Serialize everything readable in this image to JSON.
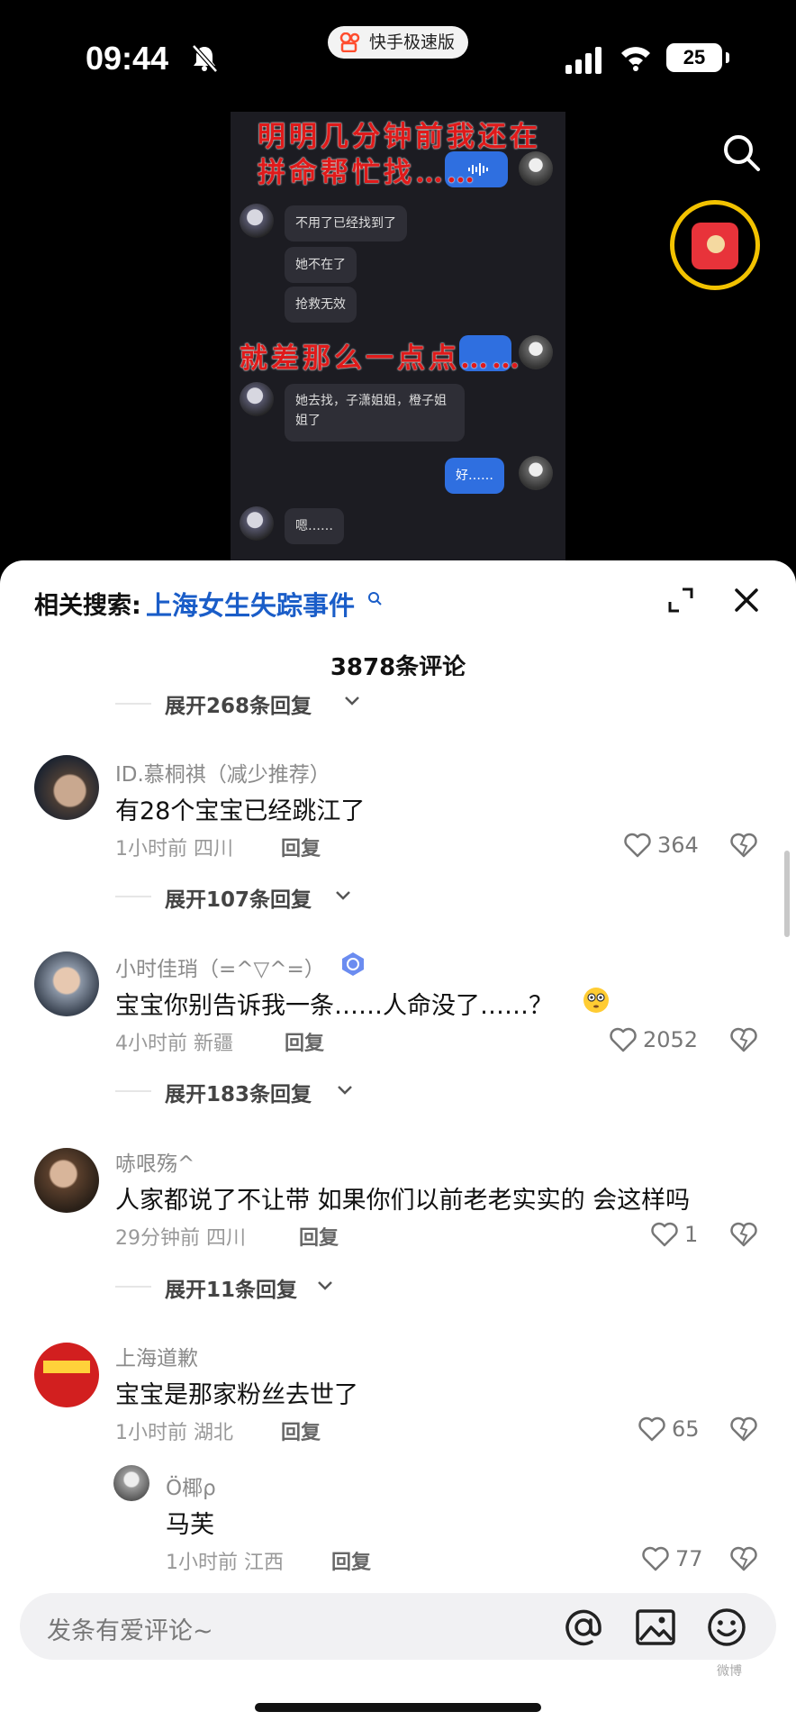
{
  "status_bar": {
    "time": "09:44",
    "app_name": "快手极速版",
    "battery": "25"
  },
  "video": {
    "overlay_top_line1": "明明几分钟前我还在",
    "overlay_top_line2": "拼命帮忙找……",
    "bubble_1": "不用了已经找到了",
    "bubble_2": "她不在了",
    "bubble_3": "抢救无效",
    "overlay_middle": "就差那么一点点……",
    "bubble_4_line1": "她去找，子潇姐姐，橙子姐",
    "bubble_4_line2": "姐了",
    "bubble_5": "好……",
    "bubble_6": "嗯……",
    "bubble_voice": "…"
  },
  "sheet": {
    "related_label": "相关搜索:",
    "related_link": "上海女生失踪事件",
    "comment_count": "3878条评论",
    "top_expand": "展开268条回复"
  },
  "comments": [
    {
      "user": "ID.慕桐祺（减少推荐）",
      "text": "有28个宝宝已经跳江了",
      "meta": "1小时前 四川",
      "reply": "回复",
      "likes": "364",
      "expand": "展开107条回复"
    },
    {
      "user": "小时佳琑（=^▽^=）",
      "text": "宝宝你别告诉我一条……人命没了……？",
      "meta": "4小时前 新疆",
      "reply": "回复",
      "likes": "2052",
      "expand": "展开183条回复"
    },
    {
      "user": "哧哏殇^",
      "text": "人家都说了不让带 如果你们以前老老实实的 会这样吗",
      "meta": "29分钟前 四川",
      "reply": "回复",
      "likes": "1",
      "expand": "展开11条回复"
    },
    {
      "user": "上海道歉",
      "text": "宝宝是那家粉丝去世了",
      "meta": "1小时前 湖北",
      "reply": "回复",
      "likes": "65"
    }
  ],
  "sub_reply": {
    "user": "Ö椰ρ",
    "text": "马芙",
    "meta": "1小时前 江西",
    "reply": "回复",
    "likes": "77"
  },
  "composer": {
    "placeholder": "发条有爱评论~"
  },
  "watermark": "微博"
}
